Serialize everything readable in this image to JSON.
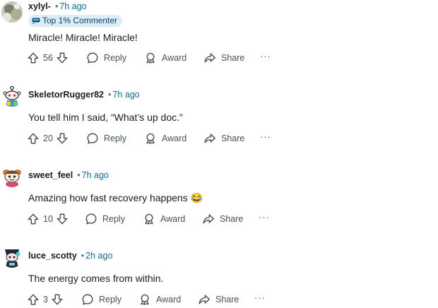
{
  "comments": [
    {
      "username": "xylyl-",
      "time": "7h ago",
      "badge": "Top 1% Commenter",
      "text": "Miracle! Miracle! Miracle!",
      "votes": "56",
      "reply": "Reply",
      "award": "Award",
      "share": "Share",
      "more": "···"
    },
    {
      "username": "SkeletorRugger82",
      "time": "7h ago",
      "text": "You tell him I said, “What’s up doc.”",
      "votes": "20",
      "reply": "Reply",
      "award": "Award",
      "share": "Share",
      "more": "···"
    },
    {
      "username": "sweet_feel",
      "time": "7h ago",
      "text": "Amazing how fast recovery happens 😂",
      "votes": "10",
      "reply": "Reply",
      "award": "Award",
      "share": "Share",
      "more": "···"
    },
    {
      "username": "luce_scotty",
      "time": "2h ago",
      "text": "The energy comes from within.",
      "votes": "3",
      "reply": "Reply",
      "award": "Award",
      "share": "Share",
      "more": "···"
    }
  ],
  "colors": {
    "time": "#0f6b8f",
    "badge_bg": "#dbeef8",
    "action_text": "#44525e"
  }
}
